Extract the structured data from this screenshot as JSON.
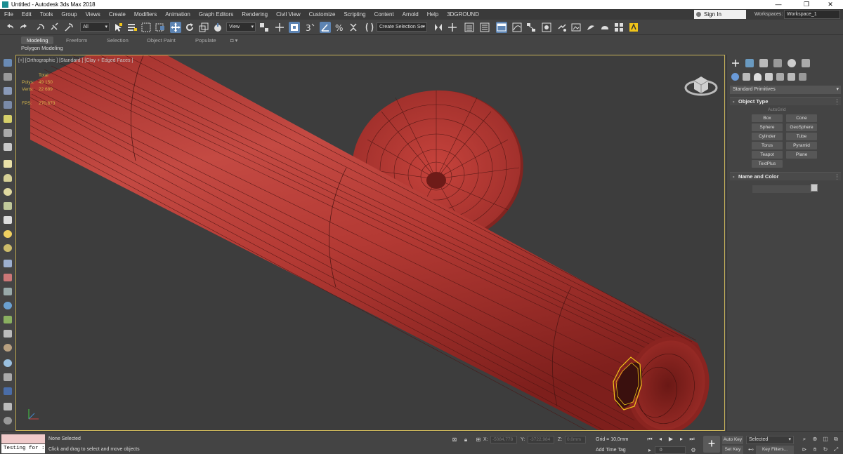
{
  "window": {
    "title": "Untitled - Autodesk 3ds Max 2018",
    "controls": [
      "—",
      "❐",
      "✕"
    ]
  },
  "menubar": {
    "items": [
      "File",
      "Edit",
      "Tools",
      "Group",
      "Views",
      "Create",
      "Modifiers",
      "Animation",
      "Graph Editors",
      "Rendering",
      "Civil View",
      "Customize",
      "Scripting",
      "Content",
      "Arnold",
      "Help",
      "3DGROUND"
    ],
    "signin": "Sign In",
    "workspaces_label": "Workspaces:",
    "workspace_value": "Workspace_1"
  },
  "toolbar": {
    "selection_filter": "All",
    "ref_coord": "View",
    "named_selection": "Create Selection Se"
  },
  "ribbon": {
    "tabs": [
      "Modeling",
      "Freeform",
      "Selection",
      "Object Paint",
      "Populate"
    ],
    "active_tab": "Modeling",
    "panel_label": "Polygon Modeling"
  },
  "viewport": {
    "label": "[+] [Orthographic ] [Standard ] [Clay + Edged Faces ]",
    "stats": {
      "header": "Total",
      "polys_label": "Polys:",
      "polys_value": "49 150",
      "verts_label": "Verts:",
      "verts_value": "22 689",
      "fps_label": "FPS:",
      "fps_value": "270,673"
    }
  },
  "command_panel": {
    "category": "Standard Primitives",
    "object_type_title": "Object Type",
    "autogrid": "AutoGrid",
    "buttons": [
      "Box",
      "Cone",
      "Sphere",
      "GeoSphere",
      "Cylinder",
      "Tube",
      "Torus",
      "Pyramid",
      "Teapot",
      "Plane",
      "TextPlus"
    ],
    "name_color_title": "Name and Color"
  },
  "statusbar": {
    "maxscript_input": "Testing for :",
    "selection_status": "None Selected",
    "prompt": "Click and drag to select and move objects",
    "x_label": "X:",
    "x_value": "-5084,778",
    "y_label": "Y:",
    "y_value": "-3722,984",
    "z_label": "Z:",
    "z_value": "0,0mm",
    "grid": "Grid = 10,0mm",
    "add_time_tag": "Add Time Tag",
    "frame_value": "0",
    "auto_key": "Auto Key",
    "set_key": "Set Key",
    "key_set": "Selected",
    "key_filters": "Key Filters..."
  },
  "colors": {
    "model_red": "#b83a34",
    "wire_dark": "#4a1412",
    "viewport_bg": "#3d3d3d",
    "active_border": "#c9b45a",
    "selection_yellow": "#f0c419",
    "toolbar_active": "#5d84b3"
  }
}
